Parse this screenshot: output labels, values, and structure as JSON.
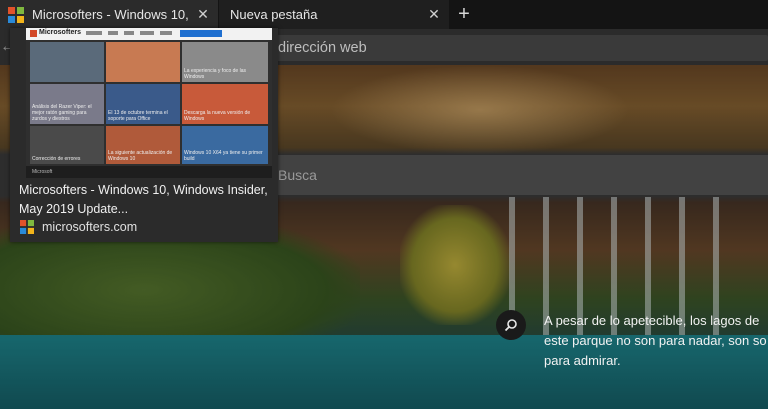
{
  "tabs": [
    {
      "title": "Microsofters - Windows 10, Windows Insider, May 2019 Update...",
      "close_icon": "close-icon",
      "active": true
    },
    {
      "title": "Nueva pestaña",
      "close_icon": "close-icon",
      "active": false
    }
  ],
  "toolbar": {
    "new_tab_icon": "plus-icon",
    "back_icon": "back-arrow-icon"
  },
  "address_bar": {
    "placeholder": "dirección web"
  },
  "page": {
    "search_placeholder": "Busca",
    "caption_lines": [
      "A pesar de lo apetecible, los lagos de",
      "este parque no son para nadar, son so",
      "para admirar."
    ],
    "search_icon": "search-icon"
  },
  "preview": {
    "title": "Microsofters - Windows 10, Windows Insider, May 2019 Update...",
    "domain": "microsofters.com",
    "thumb_logo": "Microsofters",
    "cards": [
      "Análisis del Razer Viper: el mejor ratón gaming para zurdos y diestros",
      "El 13 de octubre termina el soporte para Office",
      "La experiencia y foco de las Windows",
      "Descarga la nueva versión de Windows",
      "Windows 10 X64 ya tiene su primer build",
      "Corrección de errores",
      "La siguiente actualización de Windows 10",
      "Microsoft"
    ]
  },
  "colors": {
    "accent": "#1f6fd0",
    "tab_active_bg": "#2b2b2b",
    "tab_strip_bg": "#141414"
  }
}
